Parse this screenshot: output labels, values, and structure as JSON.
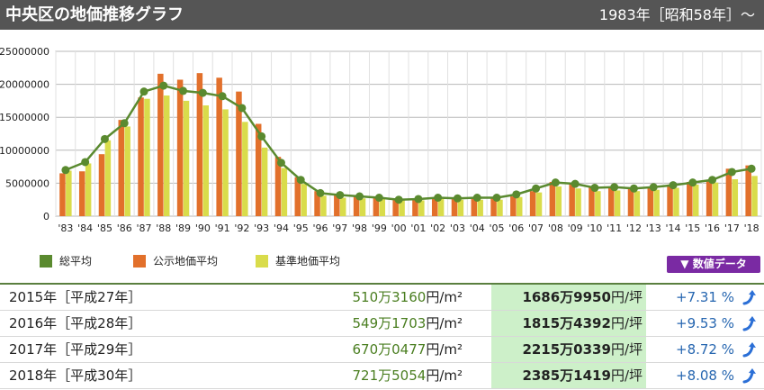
{
  "header": {
    "title": "中央区の地価推移グラフ",
    "period": "1983年［昭和58年］～"
  },
  "colors": {
    "total": "#5a8a2f",
    "public": "#e2702b",
    "standard": "#d9dc4b"
  },
  "legend": {
    "items": [
      {
        "label": "総平均",
        "color": "#5a8a2f"
      },
      {
        "label": "公示地価平均",
        "color": "#e2702b"
      },
      {
        "label": "基準地価平均",
        "color": "#d9dc4b"
      }
    ]
  },
  "data_button": {
    "label": "▼ 数値データ"
  },
  "chart_data": {
    "type": "bar",
    "title": "",
    "xlabel": "",
    "ylabel": "",
    "ylim": [
      0,
      25000000
    ],
    "yticks": [
      0,
      5000000,
      10000000,
      15000000,
      20000000,
      25000000
    ],
    "ytick_labels": [
      "0",
      "5000000",
      "10000000",
      "15000000",
      "20000000",
      "25000000"
    ],
    "categories": [
      "'83",
      "'84",
      "'85",
      "'86",
      "'87",
      "'88",
      "'89",
      "'90",
      "'91",
      "'92",
      "'93",
      "'94",
      "'95",
      "'96",
      "'97",
      "'98",
      "'99",
      "'00",
      "'01",
      "'02",
      "'03",
      "'04",
      "'05",
      "'06",
      "'07",
      "'08",
      "'09",
      "'10",
      "'11",
      "'12",
      "'13",
      "'14",
      "'15",
      "'16",
      "'17",
      "'18"
    ],
    "series": [
      {
        "name": "公示地価平均",
        "type": "bar",
        "values": [
          6500000,
          6800000,
          9400000,
          14600000,
          18000000,
          21600000,
          20700000,
          21700000,
          21000000,
          18900000,
          14000000,
          9000000,
          5900000,
          3800000,
          3300000,
          3100000,
          2800000,
          2600000,
          2600000,
          2800000,
          2600000,
          2700000,
          2800000,
          3000000,
          3800000,
          5200000,
          5000000,
          4500000,
          4400000,
          4300000,
          4500000,
          4800000,
          5200000,
          5500000,
          7200000,
          7700000
        ]
      },
      {
        "name": "基準地価平均",
        "type": "bar",
        "values": [
          6900000,
          8000000,
          11500000,
          13600000,
          17800000,
          18300000,
          17500000,
          16800000,
          16200000,
          14300000,
          10400000,
          7300000,
          4900000,
          3100000,
          2800000,
          2700000,
          2600000,
          2400000,
          2400000,
          2600000,
          2500000,
          2500000,
          2500000,
          2900000,
          3600000,
          4500000,
          4200000,
          3800000,
          3900000,
          3800000,
          4000000,
          4300000,
          4800000,
          5100000,
          5600000,
          6100000
        ]
      },
      {
        "name": "総平均",
        "type": "line",
        "values": [
          7000000,
          8200000,
          11700000,
          14100000,
          18900000,
          19800000,
          19000000,
          18700000,
          18200000,
          16400000,
          12100000,
          8100000,
          5500000,
          3500000,
          3200000,
          3000000,
          2800000,
          2500000,
          2600000,
          2800000,
          2700000,
          2800000,
          2800000,
          3300000,
          4200000,
          5100000,
          4900000,
          4300000,
          4400000,
          4200000,
          4400000,
          4700000,
          5100000,
          5500000,
          6700000,
          7200000
        ]
      }
    ]
  },
  "table": {
    "rows": [
      {
        "year": "2015年［平成27年］",
        "m2_value": "510万3160",
        "m2_unit": "円/m²",
        "tsubo_value": "1686万9950",
        "tsubo_unit": "円/坪",
        "change": "+7.31 %"
      },
      {
        "year": "2016年［平成28年］",
        "m2_value": "549万1703",
        "m2_unit": "円/m²",
        "tsubo_value": "1815万4392",
        "tsubo_unit": "円/坪",
        "change": "+9.53 %"
      },
      {
        "year": "2017年［平成29年］",
        "m2_value": "670万0477",
        "m2_unit": "円/m²",
        "tsubo_value": "2215万0339",
        "tsubo_unit": "円/坪",
        "change": "+8.72 %"
      },
      {
        "year": "2018年［平成30年］",
        "m2_value": "721万5054",
        "m2_unit": "円/m²",
        "tsubo_value": "2385万1419",
        "tsubo_unit": "円/坪",
        "change": "+8.08 %"
      }
    ]
  }
}
